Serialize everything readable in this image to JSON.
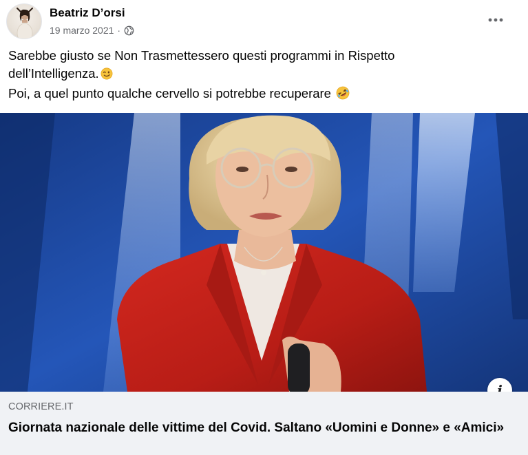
{
  "post": {
    "author": "Beatriz D’orsi",
    "date": "19 marzo 2021",
    "separator": "·",
    "privacy_icon": "globe-icon",
    "more_icon": "more-horizontal-icon",
    "text_line1": "Sarebbe giusto se Non Trasmettessero questi programmi in Rispetto",
    "text_line2": "dell’Intelligenza.",
    "text_line2_emoji": "winking-face-emoji",
    "text_line3": "Poi, a quel punto qualche cervello si potrebbe recuperare",
    "text_line3_emoji": "rolling-on-floor-laughing-emoji"
  },
  "link_preview": {
    "domain": "CORRIERE.IT",
    "title": "Giornata nazionale delle vittime del Covid. Saltano «Uomini e Donne» e «Amici»",
    "info_icon": "info-icon"
  },
  "colors": {
    "secondary_text": "#65676b",
    "link_box_bg": "#f0f2f5",
    "primary_text": "#050505"
  }
}
